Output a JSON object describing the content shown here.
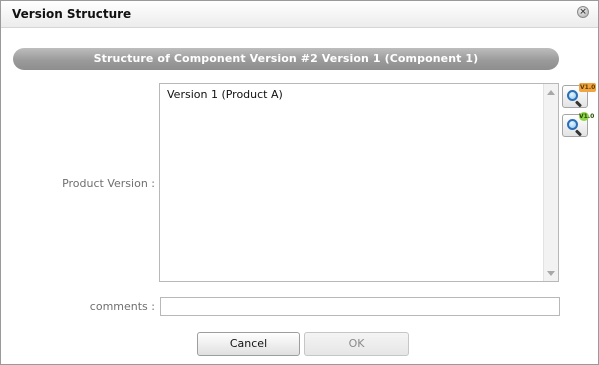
{
  "dialog": {
    "title": "Version Structure",
    "close_icon": "close-icon"
  },
  "header_band": {
    "text": "Structure of Component Version #2 Version 1 (Component 1)"
  },
  "product_version": {
    "label": "Product Version :",
    "options": [
      "Version 1 (Product A)"
    ],
    "buttons": [
      {
        "icon": "search-version-icon",
        "badge": "V1.0",
        "badge_color": "#f0a540"
      },
      {
        "icon": "search-version-plus-icon",
        "badge": "V1.0",
        "badge_color": "#8fd64b"
      }
    ]
  },
  "comments": {
    "label": "comments :",
    "value": "",
    "placeholder": ""
  },
  "actions": {
    "cancel_label": "Cancel",
    "ok_label": "OK"
  }
}
